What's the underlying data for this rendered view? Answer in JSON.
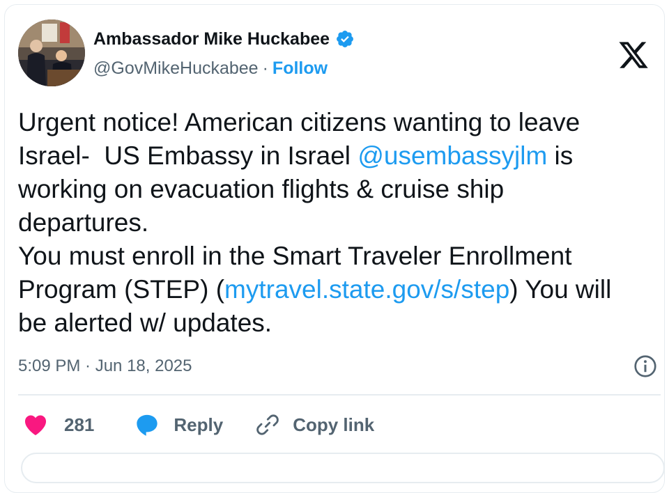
{
  "user": {
    "display_name": "Ambassador Mike Huckabee",
    "handle": "@GovMikeHuckabee",
    "separator": "·",
    "follow_label": "Follow",
    "verified": true
  },
  "tweet": {
    "text_1": "Urgent notice! American citizens wanting to leave\nIsrael-  US Embassy in Israel ",
    "mention": "@usembassyjlm",
    "text_2": " is\nworking on evacuation flights & cruise ship\ndepartures.\nYou must enroll in the Smart Traveler Enrollment\nProgram (STEP) (",
    "link": "mytravel.state.gov/s/step",
    "text_3": ") You will\nbe alerted w/ updates."
  },
  "meta": {
    "timestamp": "5:09 PM · Jun 18, 2025"
  },
  "actions": {
    "like_count": "281",
    "reply_label": "Reply",
    "copy_link_label": "Copy link"
  },
  "colors": {
    "accent": "#1d9bf0",
    "like": "#f91880",
    "text": "#0f1419",
    "muted": "#536471"
  }
}
